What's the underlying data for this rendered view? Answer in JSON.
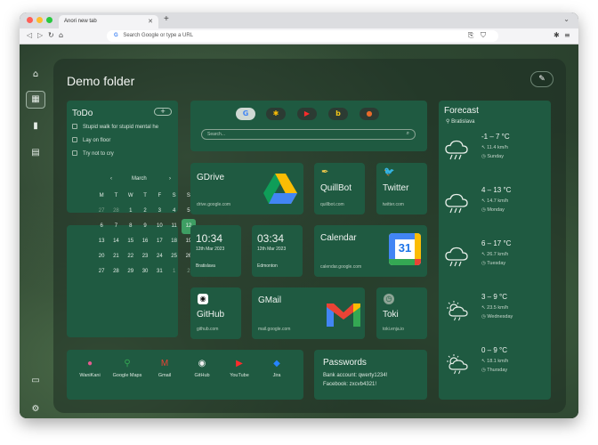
{
  "browser": {
    "tab_title": "Anori new tab",
    "new_tab": "+",
    "address_placeholder": "Search Google or type a URL"
  },
  "page": {
    "title": "Demo folder"
  },
  "todo": {
    "title": "ToDo",
    "add": "+",
    "items": [
      "Stupid walk for stupid mental he",
      "Lay on floor",
      "Try not to cry"
    ]
  },
  "search": {
    "placeholder": "Search..."
  },
  "calendar_widget": {
    "month": "March",
    "prev": "‹",
    "next": "›",
    "weekdays": [
      "M",
      "T",
      "W",
      "T",
      "F",
      "S",
      "S"
    ],
    "weeks": [
      [
        "27",
        "28",
        "1",
        "2",
        "3",
        "4",
        "5"
      ],
      [
        "6",
        "7",
        "8",
        "9",
        "10",
        "11",
        "12"
      ],
      [
        "13",
        "14",
        "15",
        "16",
        "17",
        "18",
        "19"
      ],
      [
        "20",
        "21",
        "22",
        "23",
        "24",
        "25",
        "26"
      ],
      [
        "27",
        "28",
        "29",
        "30",
        "31",
        "1",
        "2"
      ]
    ],
    "today": "12"
  },
  "links": {
    "gdrive": {
      "title": "GDrive",
      "url": "drive.google.com"
    },
    "quillbot": {
      "title": "QuillBot",
      "url": "quillbot.com"
    },
    "twitter": {
      "title": "Twitter",
      "url": "twitter.com"
    },
    "calendar": {
      "title": "Calendar",
      "url": "calendar.google.com",
      "icon_day": "31"
    },
    "github": {
      "title": "GitHub",
      "url": "github.com"
    },
    "gmail": {
      "title": "GMail",
      "url": "mail.google.com"
    },
    "toki": {
      "title": "Toki",
      "url": "toki.enja.io"
    }
  },
  "clocks": [
    {
      "time": "10:34",
      "date": "12th Mar 2023",
      "city": "Bratislava"
    },
    {
      "time": "03:34",
      "date": "12th Mar 2023",
      "city": "Edmonton"
    }
  ],
  "bookmarks": [
    {
      "label": "WaniKani",
      "icon": "wanikani-icon"
    },
    {
      "label": "Google Maps",
      "icon": "maps-pin-icon"
    },
    {
      "label": "Gmail",
      "icon": "gmail-icon"
    },
    {
      "label": "GitHub",
      "icon": "github-icon"
    },
    {
      "label": "YouTube",
      "icon": "youtube-icon"
    },
    {
      "label": "Jira",
      "icon": "jira-icon"
    }
  ],
  "passwords": {
    "title": "Passwords",
    "lines": [
      "Bank account: qwerty1234!",
      "Facebook: zxcvb4321!"
    ]
  },
  "forecast": {
    "title": "Forecast",
    "location": "Bratislava",
    "days": [
      {
        "temp": "-1 – 7 °C",
        "wind": "11.4 km/h",
        "day": "Sunday",
        "icon": "rain-cloud-icon"
      },
      {
        "temp": "4 – 13 °C",
        "wind": "14.7 km/h",
        "day": "Monday",
        "icon": "rain-cloud-icon"
      },
      {
        "temp": "6 – 17 °C",
        "wind": "26.7 km/h",
        "day": "Tuesday",
        "icon": "rain-cloud-icon"
      },
      {
        "temp": "3 – 9 °C",
        "wind": "23.5 km/h",
        "day": "Wednesday",
        "icon": "sun-rain-icon"
      },
      {
        "temp": "0 – 9 °C",
        "wind": "18.1 km/h",
        "day": "Thursday",
        "icon": "sun-rain-icon"
      }
    ]
  },
  "colors": {
    "card": "#1f5a41",
    "today_highlight": "#3e9e63"
  }
}
